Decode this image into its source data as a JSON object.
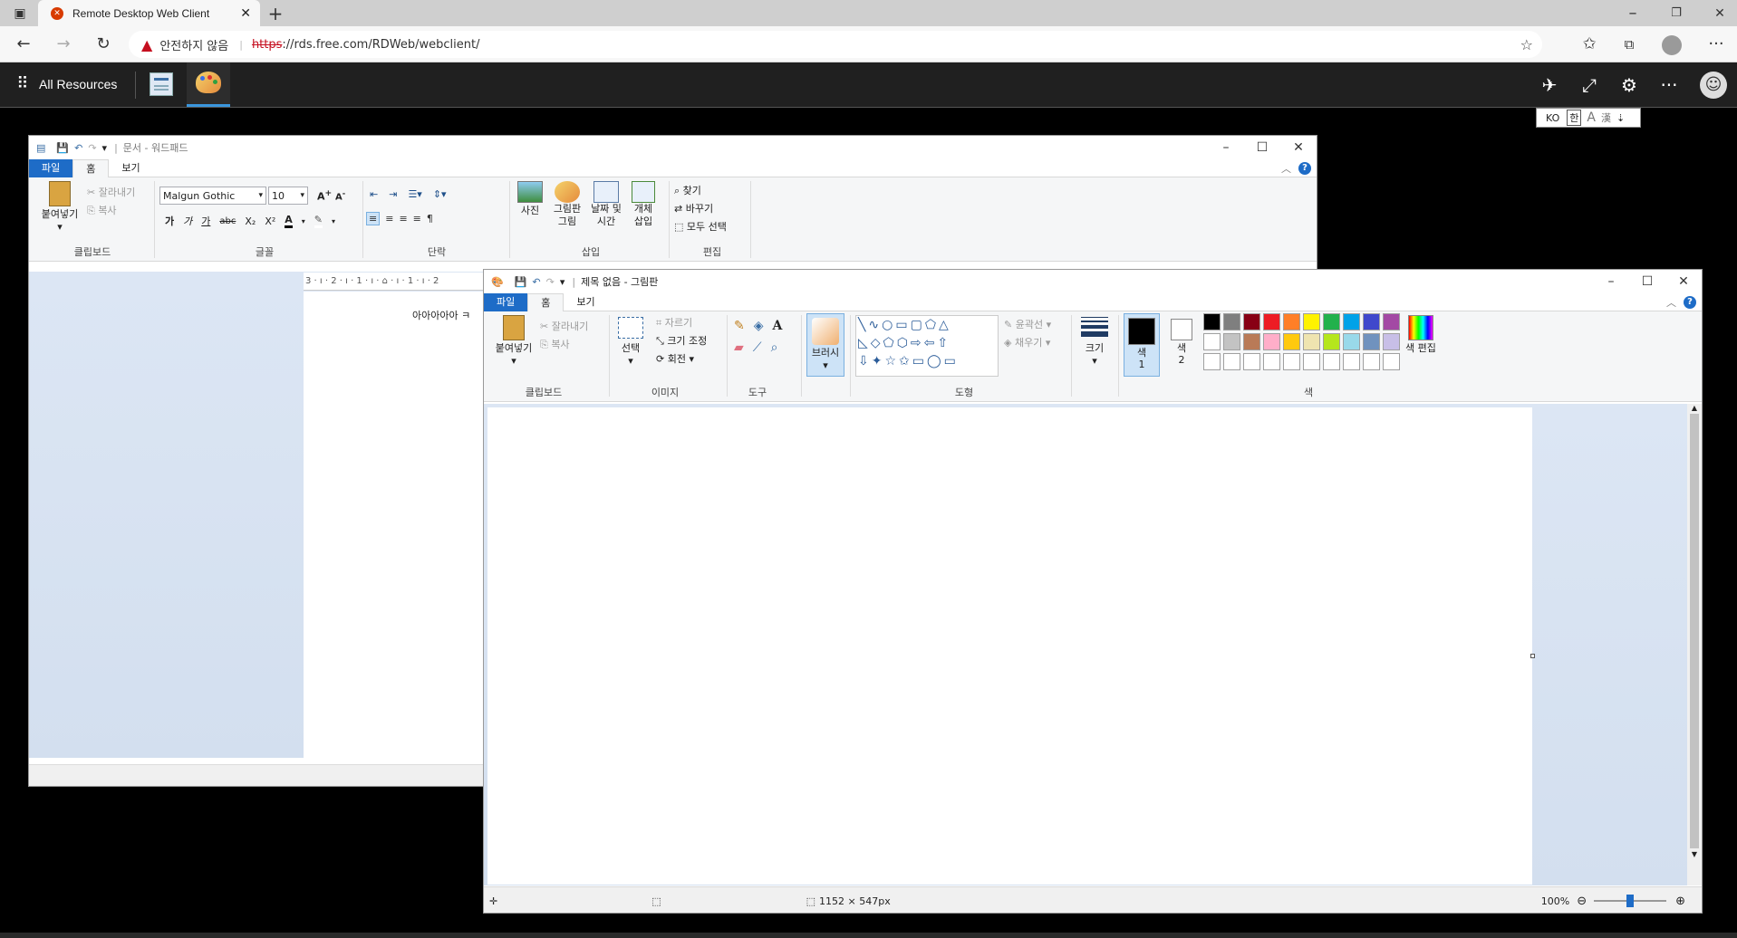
{
  "browser": {
    "tab_title": "Remote Desktop Web Client",
    "security_label": "안전하지 않음",
    "url_scheme": "https",
    "url_rest": "://rds.free.com/RDWeb/webclient/"
  },
  "rd": {
    "all_resources": "All Resources",
    "ime_ko": "KO",
    "ime_han": "한"
  },
  "wordpad": {
    "title": "문서 - 워드패드",
    "tabs": [
      "파일",
      "홈",
      "보기"
    ],
    "clipboard": {
      "paste": "붙여넣기",
      "cut": "잘라내기",
      "copy": "복사",
      "label": "클립보드"
    },
    "font": {
      "name": "Malgun Gothic",
      "size": "10",
      "label": "글꼴",
      "bold": "가",
      "italic": "가",
      "underline": "가",
      "strike": "abc"
    },
    "paragraph": {
      "label": "단락"
    },
    "insert": {
      "picture": "사진",
      "paint_drawing": "그림판 그림",
      "datetime": "날짜 및 시간",
      "object": "개체 삽입",
      "label": "삽입"
    },
    "edit": {
      "find": "찾기",
      "replace": "바꾸기",
      "select_all": "모두 선택",
      "label": "편집"
    },
    "ruler": "3 · ı · 2 · ı · 1 · ı · ⌂ · ı · 1 · ı · 2",
    "doc_text": "아아아아아 ㅋ"
  },
  "paint": {
    "title": "제목 없음 - 그림판",
    "tabs": [
      "파일",
      "홈",
      "보기"
    ],
    "clipboard": {
      "paste": "붙여넣기",
      "cut": "잘라내기",
      "copy": "복사",
      "label": "클립보드"
    },
    "image": {
      "select": "선택",
      "crop": "자르기",
      "resize": "크기 조정",
      "rotate": "회전",
      "label": "이미지"
    },
    "tools": {
      "label": "도구"
    },
    "brush": {
      "label": "브러시"
    },
    "shapes": {
      "outline": "윤곽선",
      "fill": "채우기",
      "label": "도형"
    },
    "size": {
      "label": "크기"
    },
    "color1": {
      "label": "색\n1"
    },
    "color2": {
      "label": "색\n2"
    },
    "colors": {
      "label": "색",
      "edit": "색 편집"
    },
    "palette_row1": [
      "#000000",
      "#7f7f7f",
      "#880015",
      "#ed1c24",
      "#ff7f27",
      "#fff200",
      "#22b14c",
      "#00a2e8",
      "#3f48cc",
      "#a349a4"
    ],
    "palette_row2": [
      "#ffffff",
      "#c3c3c3",
      "#b97a57",
      "#ffaec9",
      "#ffc90e",
      "#efe4b0",
      "#b5e61d",
      "#99d9ea",
      "#7092be",
      "#c8bfe7"
    ],
    "status": {
      "dimensions": "1152 × 547px",
      "zoom": "100%"
    }
  }
}
